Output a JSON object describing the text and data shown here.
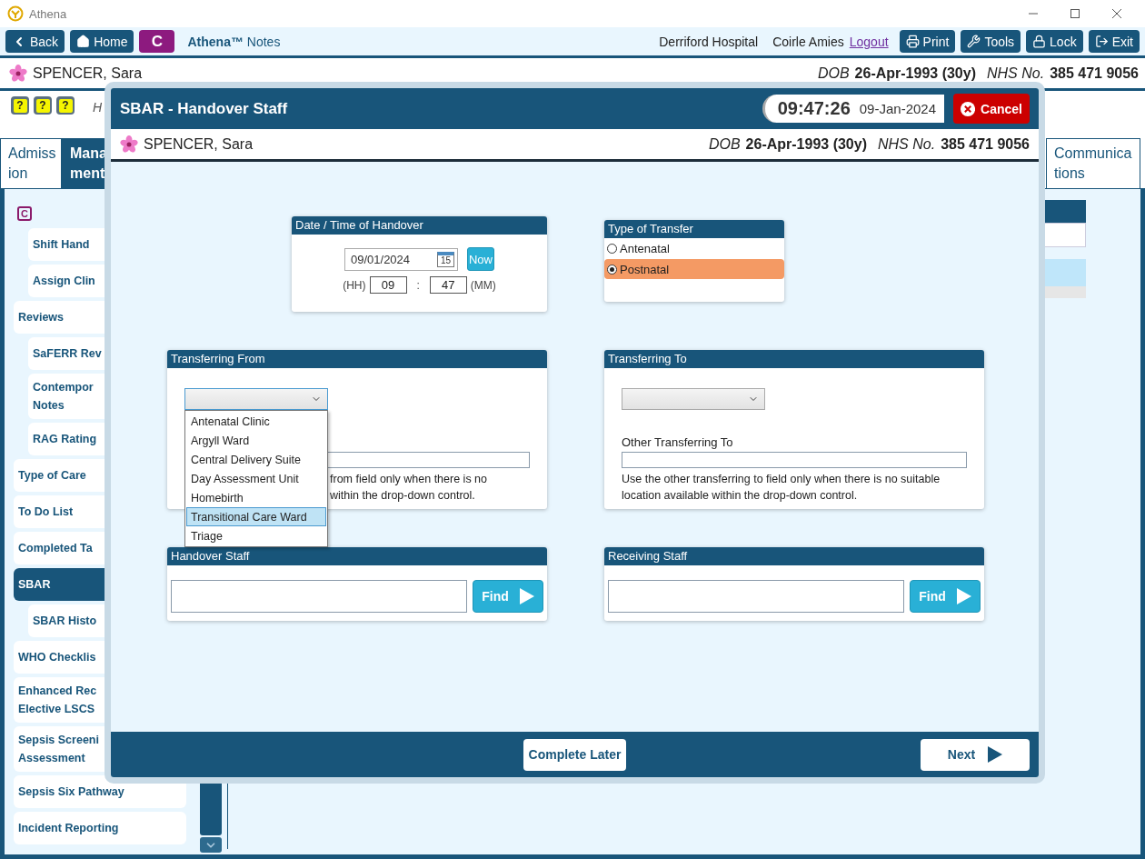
{
  "window": {
    "title": "Athena"
  },
  "toolbar": {
    "back": "Back",
    "home": "Home",
    "c_button": "C",
    "brand": "**Athena™** Notes",
    "hospital": "Derriford Hospital",
    "user": "Coirle Amies",
    "logout": "Logout",
    "buttons": [
      {
        "kind": "print",
        "label": "Print"
      },
      {
        "kind": "tools",
        "label": "Tools"
      },
      {
        "kind": "lock",
        "label": "Lock"
      },
      {
        "kind": "exit",
        "label": "Exit"
      }
    ]
  },
  "patient": {
    "name": "SPENCER, Sara",
    "dob_label": "DOB",
    "dob": "26-Apr-1993 (30y)",
    "nhs_label": "NHS No.",
    "nhs": "385 471 9056"
  },
  "alert_icons": [
    {
      "symbol": "?"
    },
    {
      "symbol": "?"
    },
    {
      "symbol": "?"
    }
  ],
  "hint_text": "H",
  "tabs": [
    {
      "lines": [
        "Admiss",
        "ion"
      ],
      "selected": false
    },
    {
      "lines": [
        "Mana",
        "ment"
      ],
      "selected": true
    },
    {
      "lines": [
        "Communica",
        "tions"
      ],
      "selected": false
    }
  ],
  "sidebar": {
    "badge": "C",
    "continued_children": [
      {
        "label": "Shift Hand",
        "selected": false
      },
      {
        "label": "Assign Clin",
        "selected": false
      }
    ],
    "items": [
      {
        "label": "Reviews",
        "selected": false,
        "children": [
          {
            "label": "SaFERR Rev",
            "selected": false
          },
          {
            "label": "Contempor\nNotes",
            "selected": false
          },
          {
            "label": "RAG Rating",
            "selected": false
          }
        ]
      },
      {
        "label": "Type of Care",
        "selected": false
      },
      {
        "label": "To Do List",
        "selected": false
      },
      {
        "label": "Completed Ta",
        "selected": false
      },
      {
        "label": "SBAR",
        "selected": true,
        "children": [
          {
            "label": "SBAR Histo",
            "selected": false
          }
        ]
      },
      {
        "label": "WHO Checklis",
        "selected": false
      },
      {
        "label": "Enhanced Rec\nElective LSCS",
        "selected": false
      },
      {
        "label": "Sepsis Screeni\nAssessment",
        "selected": false
      },
      {
        "label": "Sepsis Six Pathway",
        "selected": false
      },
      {
        "label": "Incident Reporting",
        "selected": false
      }
    ]
  },
  "modal": {
    "title": "SBAR - Handover Staff",
    "time": "09:47:26",
    "date": "09-Jan-2024",
    "cancel": "Cancel",
    "patient": {
      "name": "SPENCER, Sara",
      "dob_label": "DOB",
      "dob": "26-Apr-1993 (30y)",
      "nhs_label": "NHS No.",
      "nhs": "385 471 9056"
    },
    "handover_time": {
      "title": "Date / Time of Handover",
      "date": "09/01/2024",
      "calendar_day": "15",
      "now": "Now",
      "hh_label": "(HH)",
      "hh": "09",
      "separator": ":",
      "mm": "47",
      "mm_label": "(MM)"
    },
    "transfer_type": {
      "title": "Type of Transfer",
      "options": [
        {
          "label": "Antenatal",
          "selected": false
        },
        {
          "label": "Postnatal",
          "selected": true
        }
      ]
    },
    "transferring_from": {
      "title": "Transferring From",
      "dropdown": {
        "expanded": true,
        "options": [
          {
            "label": "Antenatal Clinic",
            "selected": false
          },
          {
            "label": "Argyll Ward",
            "selected": false
          },
          {
            "label": "Central Delivery Suite",
            "selected": false
          },
          {
            "label": "Day Assessment Unit",
            "selected": false
          },
          {
            "label": "Homebirth",
            "selected": false
          },
          {
            "label": "Transitional Care Ward",
            "selected": true
          },
          {
            "label": "Triage",
            "selected": false
          }
        ]
      },
      "help_lines": [
        "from field only when there is no",
        "within the drop-down control."
      ]
    },
    "transferring_to": {
      "title": "Transferring To",
      "dropdown": {
        "expanded": false
      },
      "other_label": "Other Transferring To",
      "help": "Use the other transferring to field only when there is no suitable location available within the drop-down control."
    },
    "handover_staff": {
      "title": "Handover Staff",
      "find": "Find"
    },
    "receiving_staff": {
      "title": "Receiving Staff",
      "find": "Find"
    },
    "footer": {
      "complete_later": "Complete Later",
      "next": "Next"
    }
  }
}
